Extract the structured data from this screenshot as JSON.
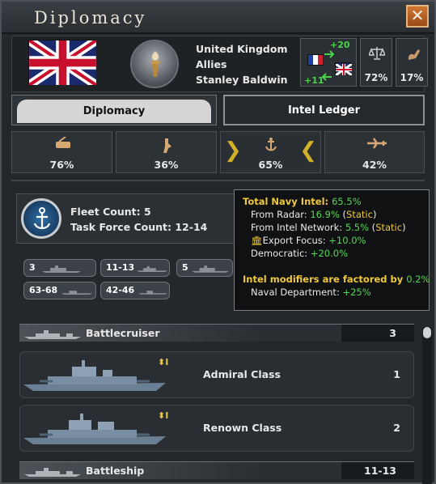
{
  "window": {
    "title": "Diplomacy",
    "close_label": "✕"
  },
  "country": {
    "name": "United Kingdom",
    "faction": "Allies",
    "leader": "Stanley Baldwin",
    "relation_up": "+20",
    "relation_down": "+11",
    "stat1": "72%",
    "stat2": "17%"
  },
  "tabs": [
    {
      "label": "Diplomacy"
    },
    {
      "label": "Intel Ledger"
    }
  ],
  "categories": [
    {
      "name": "army-icon",
      "value": "76%"
    },
    {
      "name": "air-icon",
      "value": "36%"
    },
    {
      "name": "navy-icon",
      "value": "65%"
    },
    {
      "name": "airforce-icon",
      "value": "42%"
    }
  ],
  "fleet": {
    "fleet_count": "Fleet Count: 5",
    "task_force": "Task Force Count: 12-14"
  },
  "chips": [
    "3",
    "11-13",
    "5",
    "63-68",
    "42-46"
  ],
  "tooltip": {
    "l1a": "Total Navy Intel: ",
    "l1b": "65.5%",
    "l2a": "From Radar: ",
    "l2b": "16.9%",
    "l2c": " (",
    "l2d": "Static",
    "l2e": ")",
    "l3a": "From Intel Network: ",
    "l3b": "5.5%",
    "l3c": " (",
    "l3d": "Static",
    "l3e": ")",
    "l4a": "Export Focus: ",
    "l4b": "+10.0%",
    "l5a": "Democratic: ",
    "l5b": "+20.0%",
    "l6a": "Intel modifiers are factored by ",
    "l6b": "0.2%",
    "l7a": "Naval Department: ",
    "l7b": "+25%"
  },
  "list": {
    "groups": [
      {
        "name": "Battlecruiser",
        "count": "3"
      },
      {
        "name": "Battleship",
        "count": "11-13"
      }
    ],
    "ships": [
      {
        "class": "Admiral Class",
        "count": "1",
        "tier": "I"
      },
      {
        "class": "Renown Class",
        "count": "2",
        "tier": "I"
      }
    ]
  },
  "colors": {
    "accent_gold": "#f0c93a",
    "positive_green": "#57d657",
    "close_orange": "#d07832"
  }
}
